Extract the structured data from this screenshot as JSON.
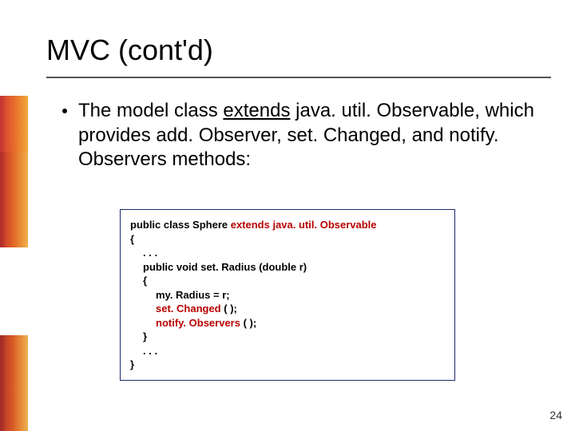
{
  "title": "MVC (cont'd)",
  "bullet": {
    "pre": "The model class ",
    "underlined": "extends",
    "post_a": " java. util. Observable, which provides add. Observer, set. Changed, and notify. Observers methods:"
  },
  "code": {
    "l1a": "public class Sphere ",
    "l1b": "extends java. util. Observable",
    "l2": "{",
    "l3": ". . .",
    "l4": "public void set. Radius (double r)",
    "l5": "{",
    "l6": "my. Radius = r;",
    "l7a": "set. Changed ",
    "l7b": "( );",
    "l8a": "notify. Observers ",
    "l8b": "( );",
    "l9": "}",
    "l10": ". . .",
    "l11": "}"
  },
  "page_number": "24"
}
